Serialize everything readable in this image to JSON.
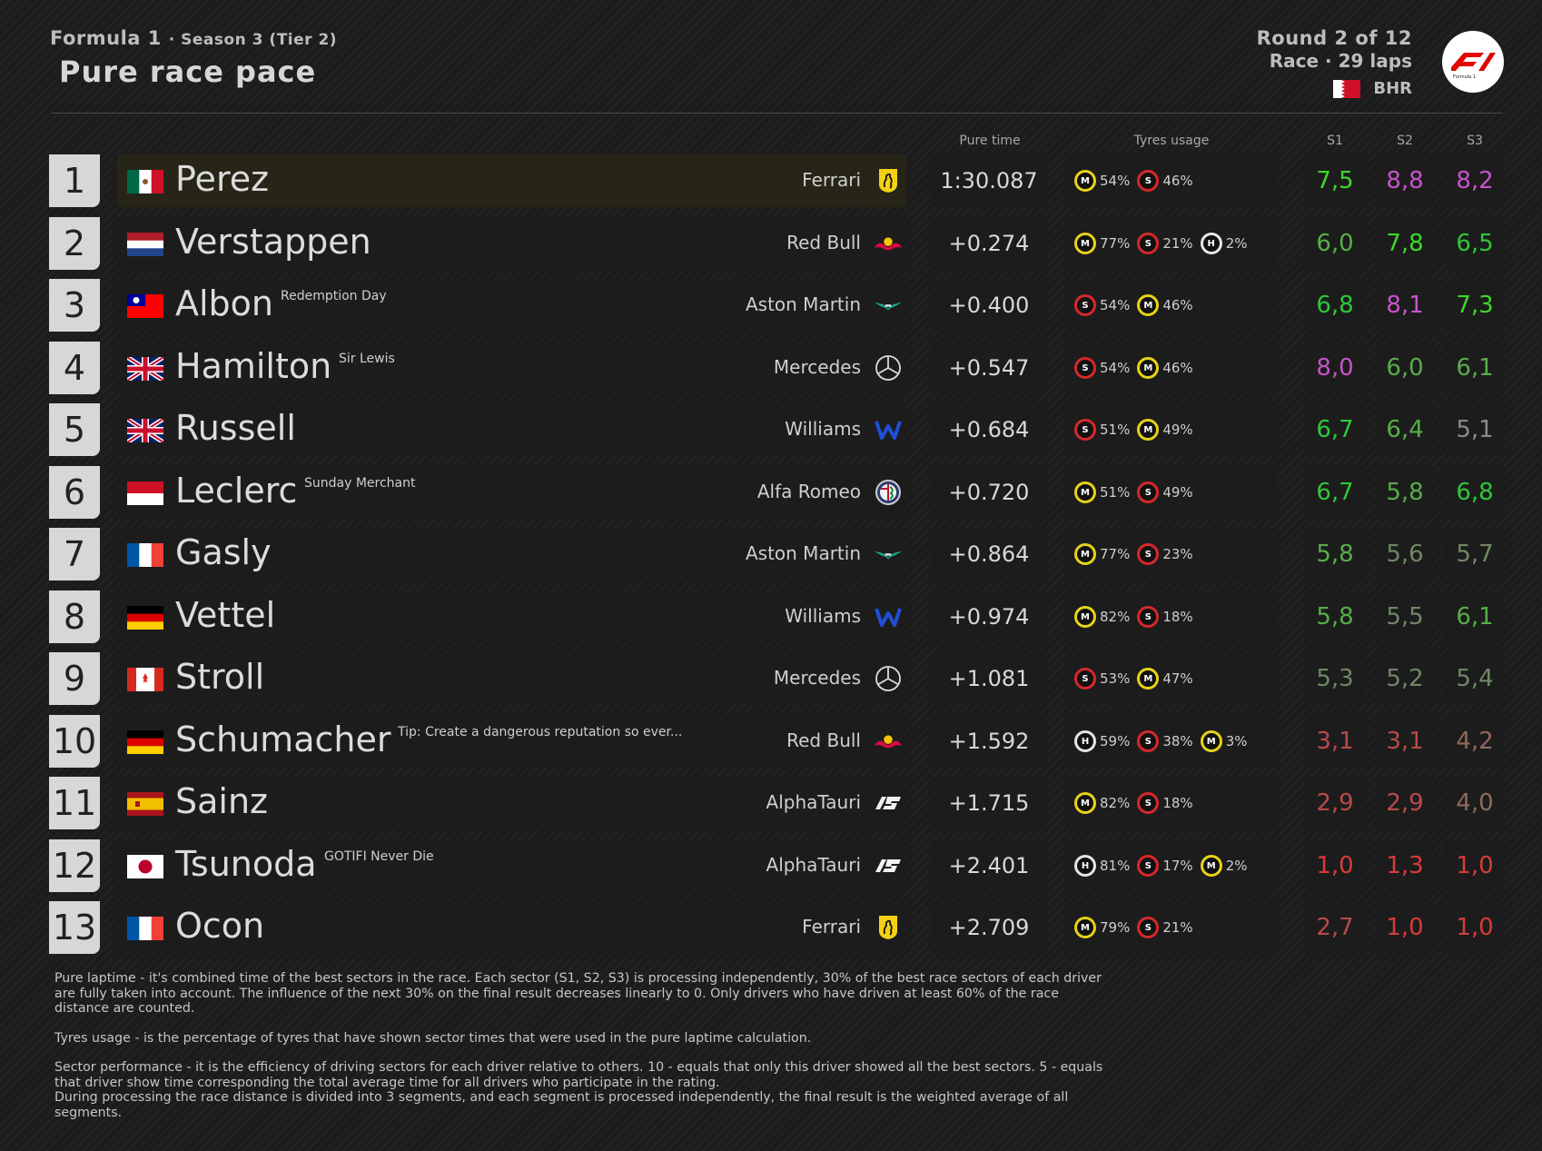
{
  "header": {
    "series": "Formula 1",
    "season": "Season 3 (Tier 2)",
    "title": "Pure race pace",
    "round": "Round 2 of 12",
    "race": "Race · 29 laps",
    "country": "BHR",
    "logo_icon": "f1-logo-icon"
  },
  "columns": {
    "pure_time": "Pure time",
    "tyres": "Tyres usage",
    "s1": "S1",
    "s2": "S2",
    "s3": "S3"
  },
  "sector_colors": {
    "purple": "#c653c9",
    "bright_green": "#3ed82a",
    "green": "#2ec73a",
    "mid_green": "#58ad4a",
    "grey_green": "#6f8766",
    "brownish": "#8f6a5c",
    "dim_red": "#b84a48",
    "red": "#d83a3a"
  },
  "rows": [
    {
      "pos": "1",
      "flag": "mx",
      "name": "Perez",
      "nick": "",
      "team": "Ferrari",
      "logo": "ferrari-horse-icon",
      "time": "1:30.087",
      "tyres": [
        {
          "c": "M",
          "p": "54%"
        },
        {
          "c": "S",
          "p": "46%"
        }
      ],
      "s1": "7,5",
      "s1c": "#3ed82a",
      "s2": "8,8",
      "s2c": "#c653c9",
      "s3": "8,2",
      "s3c": "#c653c9",
      "lead": true
    },
    {
      "pos": "2",
      "flag": "nl",
      "name": "Verstappen",
      "nick": "",
      "team": "Red Bull",
      "logo": "red-bull-icon",
      "time": "+0.274",
      "tyres": [
        {
          "c": "M",
          "p": "77%"
        },
        {
          "c": "S",
          "p": "21%"
        },
        {
          "c": "H",
          "p": "2%"
        }
      ],
      "s1": "6,0",
      "s1c": "#58ad4a",
      "s2": "7,8",
      "s2c": "#3ed82a",
      "s3": "6,5",
      "s3c": "#2ec73a"
    },
    {
      "pos": "3",
      "flag": "tw",
      "name": "Albon",
      "nick": "Redemption Day",
      "team": "Aston Martin",
      "logo": "aston-martin-wings-icon",
      "time": "+0.400",
      "tyres": [
        {
          "c": "S",
          "p": "54%"
        },
        {
          "c": "M",
          "p": "46%"
        }
      ],
      "s1": "6,8",
      "s1c": "#2ec73a",
      "s2": "8,1",
      "s2c": "#c653c9",
      "s3": "7,3",
      "s3c": "#3ed82a"
    },
    {
      "pos": "4",
      "flag": "gb",
      "name": "Hamilton",
      "nick": "Sir Lewis",
      "team": "Mercedes",
      "logo": "mercedes-star-icon",
      "time": "+0.547",
      "tyres": [
        {
          "c": "S",
          "p": "54%"
        },
        {
          "c": "M",
          "p": "46%"
        }
      ],
      "s1": "8,0",
      "s1c": "#c653c9",
      "s2": "6,0",
      "s2c": "#58ad4a",
      "s3": "6,1",
      "s3c": "#58ad4a"
    },
    {
      "pos": "5",
      "flag": "gb",
      "name": "Russell",
      "nick": "",
      "team": "Williams",
      "logo": "williams-w-icon",
      "time": "+0.684",
      "tyres": [
        {
          "c": "S",
          "p": "51%"
        },
        {
          "c": "M",
          "p": "49%"
        }
      ],
      "s1": "6,7",
      "s1c": "#2ec73a",
      "s2": "6,4",
      "s2c": "#58ad4a",
      "s3": "5,1",
      "s3c": "#8a8a8a"
    },
    {
      "pos": "6",
      "flag": "mc",
      "name": "Leclerc",
      "nick": "Sunday Merchant",
      "team": "Alfa Romeo",
      "logo": "alfa-romeo-icon",
      "time": "+0.720",
      "tyres": [
        {
          "c": "M",
          "p": "51%"
        },
        {
          "c": "S",
          "p": "49%"
        }
      ],
      "s1": "6,7",
      "s1c": "#2ec73a",
      "s2": "5,8",
      "s2c": "#58ad4a",
      "s3": "6,8",
      "s3c": "#2ec73a"
    },
    {
      "pos": "7",
      "flag": "fr",
      "name": "Gasly",
      "nick": "",
      "team": "Aston Martin",
      "logo": "aston-martin-wings-icon",
      "time": "+0.864",
      "tyres": [
        {
          "c": "M",
          "p": "77%"
        },
        {
          "c": "S",
          "p": "23%"
        }
      ],
      "s1": "5,8",
      "s1c": "#58ad4a",
      "s2": "5,6",
      "s2c": "#6f8766",
      "s3": "5,7",
      "s3c": "#6f8766"
    },
    {
      "pos": "8",
      "flag": "de",
      "name": "Vettel",
      "nick": "",
      "team": "Williams",
      "logo": "williams-w-icon",
      "time": "+0.974",
      "tyres": [
        {
          "c": "M",
          "p": "82%"
        },
        {
          "c": "S",
          "p": "18%"
        }
      ],
      "s1": "5,8",
      "s1c": "#58ad4a",
      "s2": "5,5",
      "s2c": "#6f8766",
      "s3": "6,1",
      "s3c": "#58ad4a"
    },
    {
      "pos": "9",
      "flag": "ca",
      "name": "Stroll",
      "nick": "",
      "team": "Mercedes",
      "logo": "mercedes-star-icon",
      "time": "+1.081",
      "tyres": [
        {
          "c": "S",
          "p": "53%"
        },
        {
          "c": "M",
          "p": "47%"
        }
      ],
      "s1": "5,3",
      "s1c": "#6f8766",
      "s2": "5,2",
      "s2c": "#6f8766",
      "s3": "5,4",
      "s3c": "#6f8766"
    },
    {
      "pos": "10",
      "flag": "de",
      "name": "Schumacher",
      "nick": "Tip: Create a dangerous reputation so ever...",
      "team": "Red Bull",
      "logo": "red-bull-icon",
      "time": "+1.592",
      "tyres": [
        {
          "c": "H",
          "p": "59%"
        },
        {
          "c": "S",
          "p": "38%"
        },
        {
          "c": "M",
          "p": "3%"
        }
      ],
      "s1": "3,1",
      "s1c": "#b84a48",
      "s2": "3,1",
      "s2c": "#b84a48",
      "s3": "4,2",
      "s3c": "#8f6a5c"
    },
    {
      "pos": "11",
      "flag": "es",
      "name": "Sainz",
      "nick": "",
      "team": "AlphaTauri",
      "logo": "alphatauri-icon",
      "time": "+1.715",
      "tyres": [
        {
          "c": "M",
          "p": "82%"
        },
        {
          "c": "S",
          "p": "18%"
        }
      ],
      "s1": "2,9",
      "s1c": "#b84a48",
      "s2": "2,9",
      "s2c": "#b84a48",
      "s3": "4,0",
      "s3c": "#8f6a5c"
    },
    {
      "pos": "12",
      "flag": "jp",
      "name": "Tsunoda",
      "nick": "GOTIFI Never Die",
      "team": "AlphaTauri",
      "logo": "alphatauri-icon",
      "time": "+2.401",
      "tyres": [
        {
          "c": "H",
          "p": "81%"
        },
        {
          "c": "S",
          "p": "17%"
        },
        {
          "c": "M",
          "p": "2%"
        }
      ],
      "s1": "1,0",
      "s1c": "#d83a3a",
      "s2": "1,3",
      "s2c": "#d83a3a",
      "s3": "1,0",
      "s3c": "#d83a3a"
    },
    {
      "pos": "13",
      "flag": "fr",
      "name": "Ocon",
      "nick": "",
      "team": "Ferrari",
      "logo": "ferrari-horse-icon",
      "time": "+2.709",
      "tyres": [
        {
          "c": "M",
          "p": "79%"
        },
        {
          "c": "S",
          "p": "21%"
        }
      ],
      "s1": "2,7",
      "s1c": "#b84a48",
      "s2": "1,0",
      "s2c": "#d83a3a",
      "s3": "1,0",
      "s3c": "#d83a3a"
    }
  ],
  "notes": {
    "pure_laptime": "Pure laptime - it's combined time of the best sectors in the race. Each sector (S1, S2, S3) is processing independently, 30% of the best race sectors of each driver are fully taken into account. The influence of the next 30% on the final result decreases linearly to 0. Only drivers who have driven at least 60% of the race distance are counted.",
    "tyres_usage": "Tyres usage - is the percentage of tyres that have shown sector times that were used in the pure laptime calculation.",
    "sector_performance": "Sector performance - it is the efficiency of driving sectors for each driver relative to others. 10 - equals that only this driver showed all the best sectors. 5 - equals that driver show time corresponding the total average time for all drivers who participate in the rating.",
    "segments": "During processing the race distance is divided into 3 segments, and each segment is processed independently, the final result is the weighted average of all segments."
  }
}
